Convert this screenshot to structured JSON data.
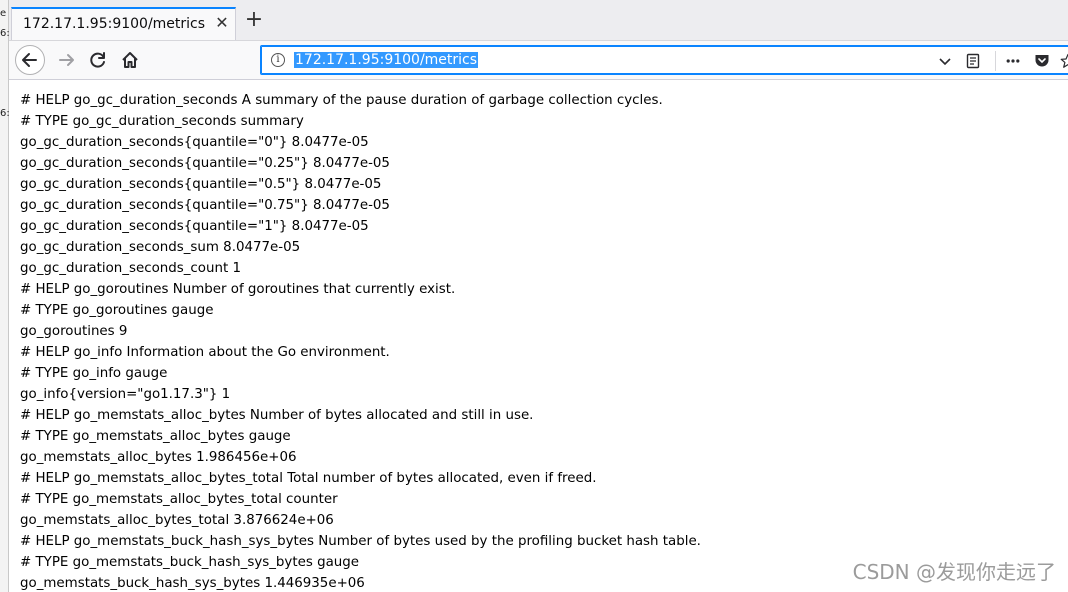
{
  "edge_strip": {
    "chars": [
      "e",
      "6:",
      "6:"
    ]
  },
  "tab": {
    "title": "172.17.1.95:9100/metrics",
    "close_glyph": "✕"
  },
  "new_tab_glyph": "+",
  "urlbar": {
    "value": "172.17.1.95:9100/metrics",
    "info_glyph": "i"
  },
  "page": {
    "lines": [
      "# HELP go_gc_duration_seconds A summary of the pause duration of garbage collection cycles.",
      "# TYPE go_gc_duration_seconds summary",
      "go_gc_duration_seconds{quantile=\"0\"} 8.0477e-05",
      "go_gc_duration_seconds{quantile=\"0.25\"} 8.0477e-05",
      "go_gc_duration_seconds{quantile=\"0.5\"} 8.0477e-05",
      "go_gc_duration_seconds{quantile=\"0.75\"} 8.0477e-05",
      "go_gc_duration_seconds{quantile=\"1\"} 8.0477e-05",
      "go_gc_duration_seconds_sum 8.0477e-05",
      "go_gc_duration_seconds_count 1",
      "# HELP go_goroutines Number of goroutines that currently exist.",
      "# TYPE go_goroutines gauge",
      "go_goroutines 9",
      "# HELP go_info Information about the Go environment.",
      "# TYPE go_info gauge",
      "go_info{version=\"go1.17.3\"} 1",
      "# HELP go_memstats_alloc_bytes Number of bytes allocated and still in use.",
      "# TYPE go_memstats_alloc_bytes gauge",
      "go_memstats_alloc_bytes 1.986456e+06",
      "# HELP go_memstats_alloc_bytes_total Total number of bytes allocated, even if freed.",
      "# TYPE go_memstats_alloc_bytes_total counter",
      "go_memstats_alloc_bytes_total 3.876624e+06",
      "# HELP go_memstats_buck_hash_sys_bytes Number of bytes used by the profiling bucket hash table.",
      "# TYPE go_memstats_buck_hash_sys_bytes gauge",
      "go_memstats_buck_hash_sys_bytes 1.446935e+06"
    ]
  },
  "watermark": "CSDN @发现你走远了",
  "colors": {
    "accent": "#0a84ff",
    "selection": "#3399ff",
    "tabbar": "#ededf0"
  },
  "icons": [
    "back-arrow-icon",
    "forward-arrow-icon",
    "reload-icon",
    "home-icon",
    "info-icon",
    "dropdown-icon",
    "reader-view-icon",
    "more-icon",
    "pocket-icon",
    "bookmark-star-icon",
    "close-icon",
    "plus-icon"
  ]
}
